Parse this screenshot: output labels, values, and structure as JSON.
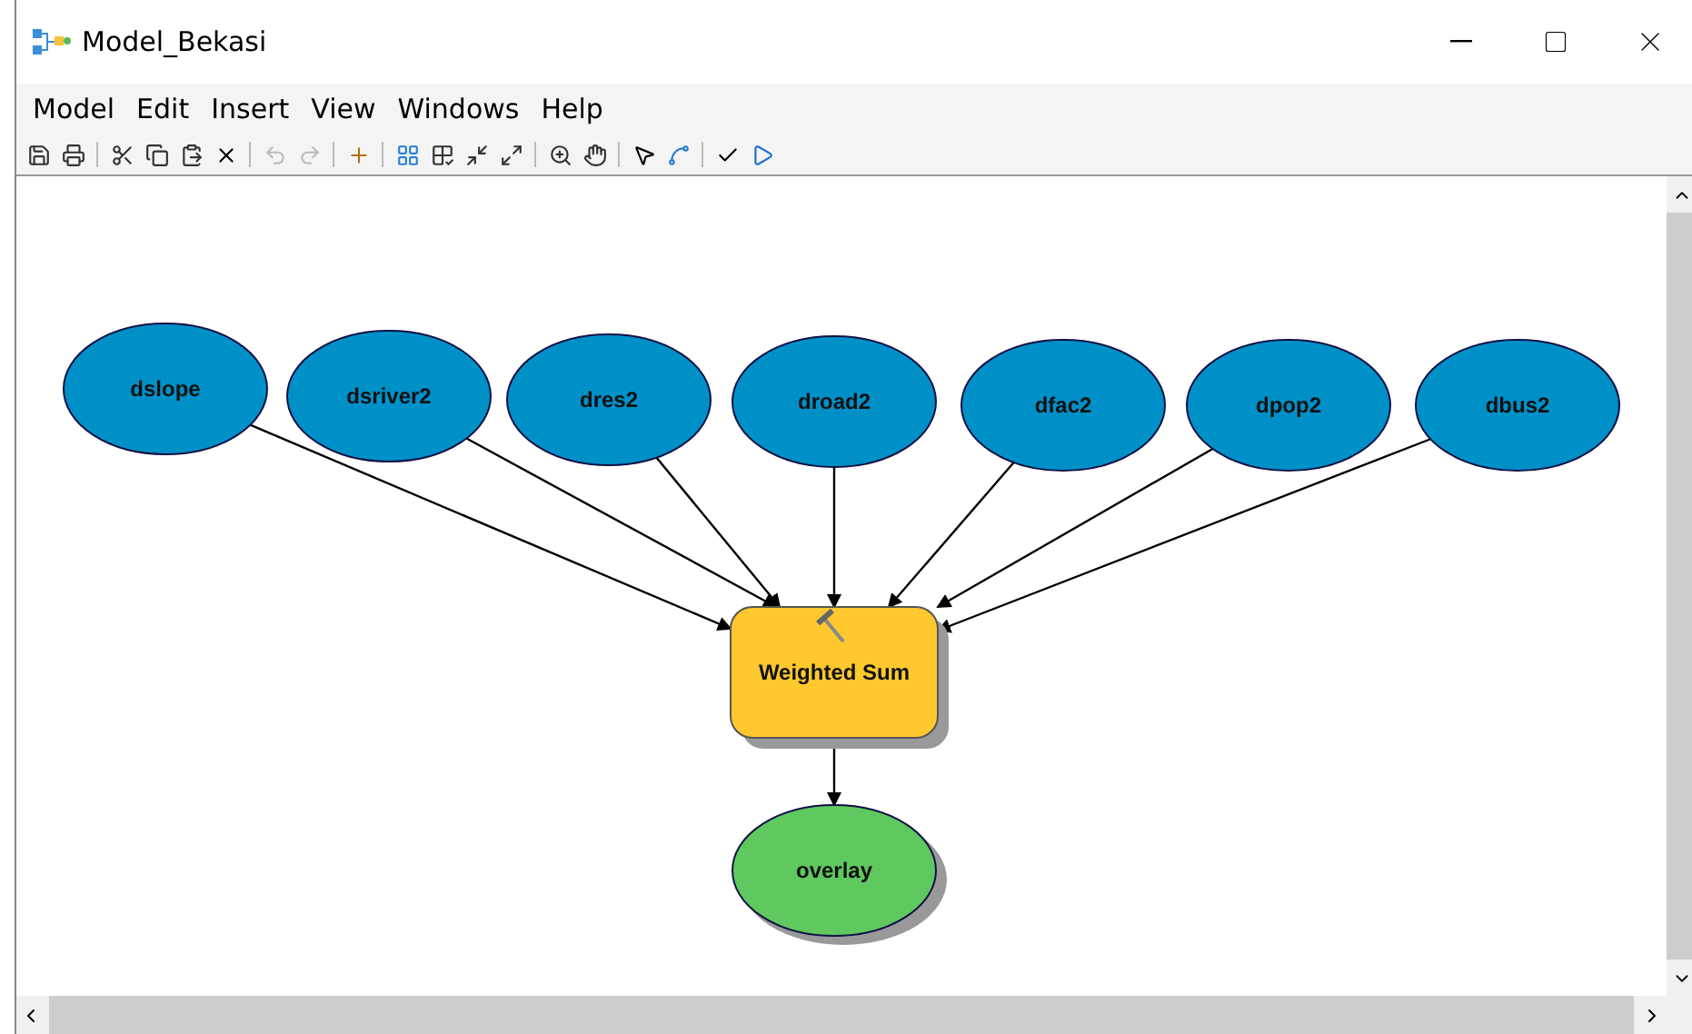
{
  "window": {
    "title": "Model_Bekasi"
  },
  "menu": [
    "Model",
    "Edit",
    "Insert",
    "View",
    "Windows",
    "Help"
  ],
  "model": {
    "nodes": [
      {
        "label": "dslope",
        "kind": "input"
      },
      {
        "label": "dsriver2",
        "kind": "input"
      },
      {
        "label": "dres2",
        "kind": "input"
      },
      {
        "label": "droad2",
        "kind": "input"
      },
      {
        "label": "dfac2",
        "kind": "input"
      },
      {
        "label": "dpop2",
        "kind": "input"
      },
      {
        "label": "dbus2",
        "kind": "input"
      },
      {
        "label": "Weighted Sum",
        "kind": "tool"
      },
      {
        "label": "overlay",
        "kind": "output"
      }
    ]
  }
}
